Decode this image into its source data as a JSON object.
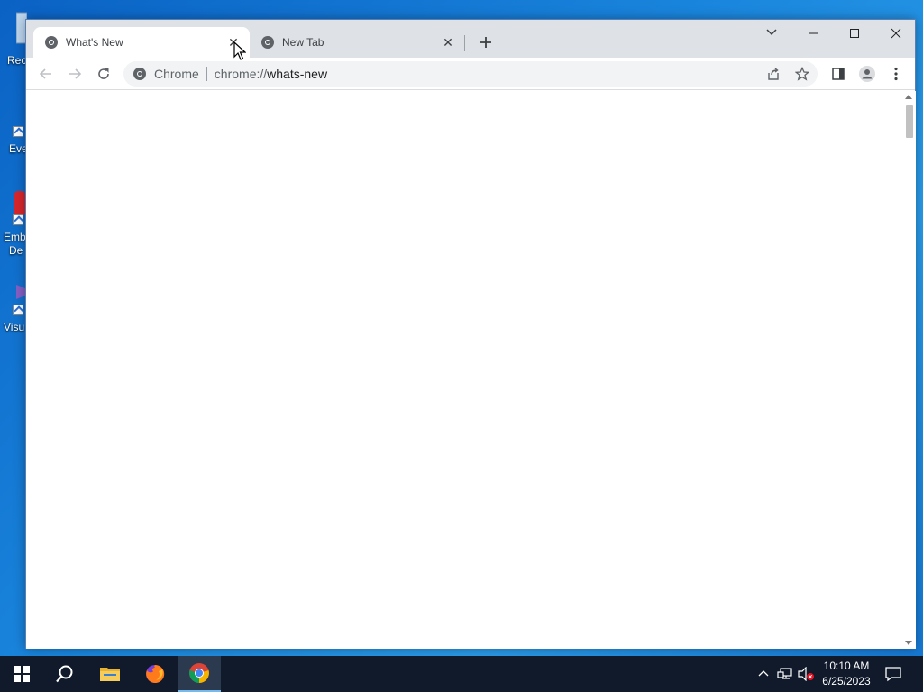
{
  "desktop": {
    "icons": [
      {
        "label": "Rec"
      },
      {
        "label": "Eve"
      },
      {
        "label": "Emb"
      },
      {
        "label": "De"
      },
      {
        "label": "Visu"
      }
    ]
  },
  "browser": {
    "tabs": [
      {
        "title": "What's New",
        "active": true
      },
      {
        "title": "New Tab",
        "active": false
      }
    ],
    "omnibox": {
      "chip": "Chrome",
      "scheme": "chrome://",
      "host": "whats-new"
    }
  },
  "taskbar": {
    "clock_time": "10:10 AM",
    "clock_date": "6/25/2023"
  },
  "colors": {
    "accent": "#1a73e8",
    "titlebar": "#dee1e6",
    "taskbar": "#101a2b"
  }
}
